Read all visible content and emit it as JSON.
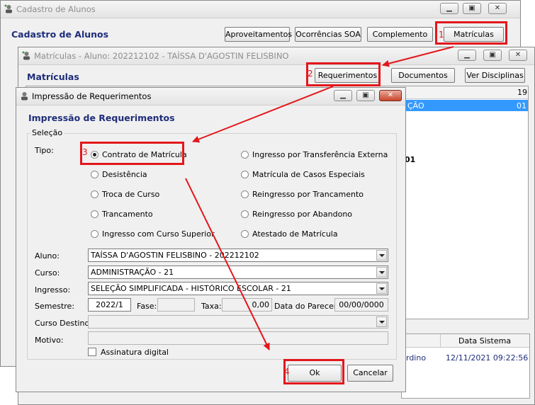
{
  "win_main": {
    "title": "Cadastro de Alunos",
    "heading": "Cadastro de Alunos",
    "buttons": {
      "aproveitamentos": "Aproveitamentos",
      "ocorrencias": "Ocorrências SOA",
      "complemento": "Complemento",
      "matriculas": "Matrículas"
    }
  },
  "win_matriculas": {
    "title": "Matrículas - Aluno: 202212102 - TAÍSSA D'AGOSTIN FELISBINO",
    "heading": "Matrículas",
    "buttons": {
      "requerimentos": "Requerimentos",
      "documentos": "Documentos",
      "ver_disciplinas": "Ver Disciplinas"
    },
    "grid_fragments": {
      "col_19": "19",
      "row1_text": "ÇÃO",
      "row1_val": "01",
      "row2_text": "01"
    },
    "bottom_grid": {
      "col_data_sistema": "Data Sistema",
      "row_name_fragment": "rdino",
      "row_datetime": "12/11/2021 09:22:56"
    }
  },
  "dialog": {
    "title": "Impressão de Requerimentos",
    "heading": "Impressão de Requerimentos",
    "group_label": "Seleção",
    "tipo_label": "Tipo:",
    "options_left": [
      {
        "label": "Contrato de Matrícula",
        "selected": true
      },
      {
        "label": "Desistência",
        "selected": false
      },
      {
        "label": "Troca de Curso",
        "selected": false
      },
      {
        "label": "Trancamento",
        "selected": false
      },
      {
        "label": "Ingresso com Curso Superior",
        "selected": false
      }
    ],
    "options_right": [
      {
        "label": "Ingresso por Transferência Externa",
        "selected": false
      },
      {
        "label": "Matrícula de Casos Especiais",
        "selected": false
      },
      {
        "label": "Reingresso por Trancamento",
        "selected": false
      },
      {
        "label": "Reingresso por Abandono",
        "selected": false
      },
      {
        "label": "Atestado de Matrícula",
        "selected": false
      }
    ],
    "fields": {
      "aluno_label": "Aluno:",
      "aluno_value": "TAÍSSA D'AGOSTIN FELISBINO - 202212102",
      "curso_label": "Curso:",
      "curso_value": "ADMINISTRAÇÃO - 21",
      "ingresso_label": "Ingresso:",
      "ingresso_value": "SELEÇÃO SIMPLIFICADA - HISTÓRICO ESCOLAR - 21",
      "semestre_label": "Semestre:",
      "semestre_value": "2022/1",
      "fase_label": "Fase:",
      "fase_value": "",
      "taxa_label": "Taxa:",
      "taxa_value": "0,00",
      "data_parecer_label": "Data do Parecer:",
      "data_parecer_value": "00/00/0000",
      "curso_destino_label": "Curso Destino:",
      "curso_destino_value": "",
      "motivo_label": "Motivo:",
      "motivo_value": "",
      "assinatura_label": "Assinatura digital",
      "assinatura_checked": false
    },
    "buttons": {
      "ok": "Ok",
      "cancelar": "Cancelar"
    }
  },
  "annotations": {
    "step1": "1",
    "step2": "2",
    "step3": "3",
    "step4": "4",
    "color": "#e3171c"
  },
  "colors": {
    "heading": "#1f2d7a",
    "selection_blue": "#3399ff",
    "close_red": "#c9462c"
  },
  "icons": {
    "title_icon": "app-user-icon",
    "minimize": "minimize-icon",
    "maximize": "maximize-icon",
    "close": "close-icon",
    "dropdown": "chevron-down-icon"
  }
}
